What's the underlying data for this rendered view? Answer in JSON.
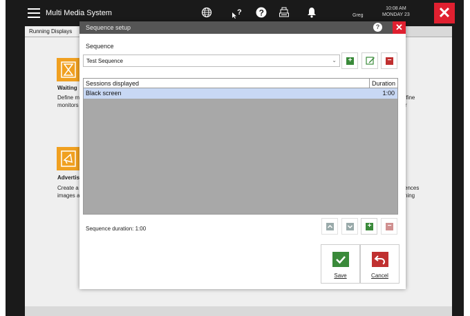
{
  "topbar": {
    "title": "Multi Media System",
    "user": "Greg",
    "time": "10:08 AM",
    "day": "MONDAY 23",
    "icons": [
      "menu-icon",
      "globe-icon",
      "help-cursor-icon",
      "help-circle-icon",
      "cash-register-icon",
      "bell-icon",
      "close-icon"
    ]
  },
  "background": {
    "tab_label": "Running Displays",
    "card1": {
      "title": "Waiting",
      "line1_left": "Define m",
      "line2_left": "monitors",
      "line1_right": "efine",
      "line2_right": "r"
    },
    "card2": {
      "title": "Advertis",
      "line1_left": "Create a",
      "line2_left": "images a",
      "line1_right": "ences",
      "line2_right": "ning"
    }
  },
  "dialog": {
    "title": "Sequence setup",
    "sequence_label": "Sequence",
    "sequence_value": "Test Sequence",
    "table": {
      "columns": [
        "Sessions displayed",
        "Duration"
      ],
      "rows": [
        {
          "session": "Black screen",
          "duration": "1:00"
        }
      ]
    },
    "sequence_duration_label": "Sequence duration: 1:00",
    "save_label": "Save",
    "cancel_label": "Cancel"
  }
}
